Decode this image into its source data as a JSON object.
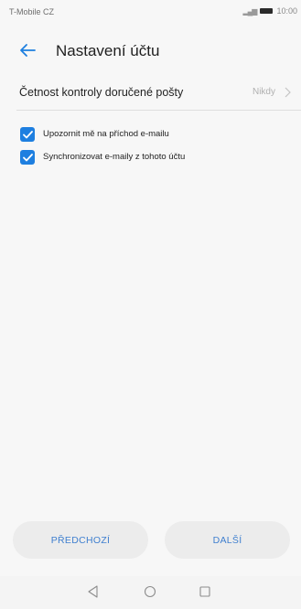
{
  "status_bar": {
    "carrier": "T-Mobile CZ",
    "time": "10:00",
    "icons": [
      "signal-icon",
      "battery-icon"
    ]
  },
  "header": {
    "title": "Nastavení účtu",
    "back_icon": "arrow-left-icon"
  },
  "settings": {
    "check_frequency": {
      "label": "Četnost kontroly doručené pošty",
      "value": "Nikdy",
      "icon": "chevron-right-icon"
    },
    "checkboxes": [
      {
        "label": "Upozornit mě na příchod e-mailu",
        "checked": true
      },
      {
        "label": "Synchronizovat e-maily z tohoto účtu",
        "checked": true
      }
    ]
  },
  "buttons": {
    "previous": "PŘEDCHOZÍ",
    "next": "DALŠÍ"
  },
  "nav_bar": {
    "icons": [
      "back-triangle-icon",
      "home-circle-icon",
      "recent-square-icon"
    ]
  },
  "colors": {
    "accent": "#1e7fe0",
    "button_text": "#3f7fcf",
    "background": "#f7f7f7",
    "button_bg": "#ececec"
  }
}
